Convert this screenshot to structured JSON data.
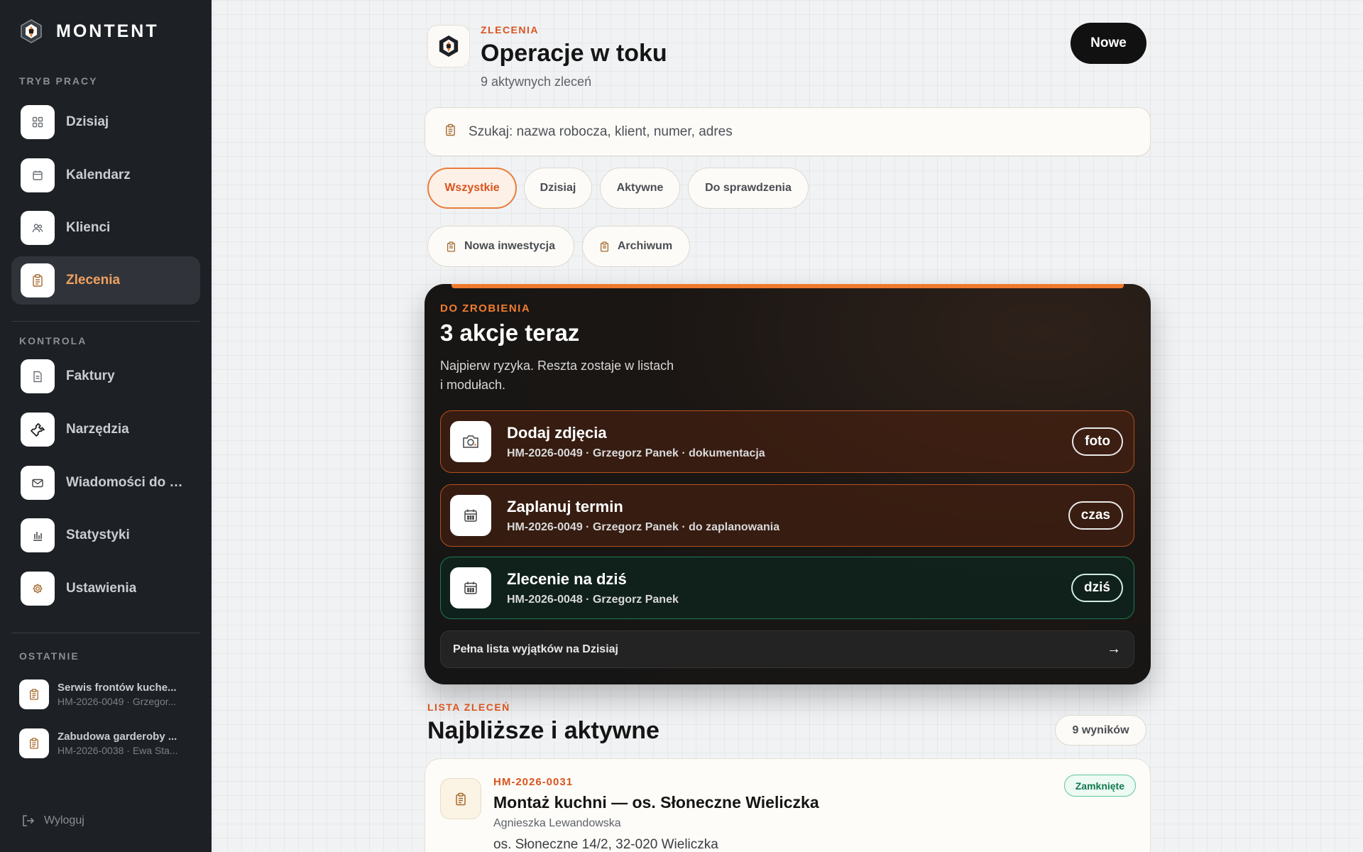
{
  "sidebar": {
    "brand": "MONTENT",
    "section_work": "TRYB PRACY",
    "nav_work": [
      {
        "label": "Dzisiaj",
        "icon": "grid-icon"
      },
      {
        "label": "Kalendarz",
        "icon": "calendar-icon"
      },
      {
        "label": "Klienci",
        "icon": "users-icon"
      },
      {
        "label": "Zlecenia",
        "icon": "clipboard-icon",
        "active": true
      }
    ],
    "section_control": "KONTROLA",
    "nav_control": [
      {
        "label": "Faktury",
        "icon": "document-icon"
      },
      {
        "label": "Narzędzia",
        "icon": "wrench-icon"
      },
      {
        "label": "Wiadomości do kl...",
        "icon": "mail-icon"
      },
      {
        "label": "Statystyki",
        "icon": "bar-chart-icon"
      },
      {
        "label": "Ustawienia",
        "icon": "gear-icon"
      }
    ],
    "section_recent": "OSTATNIE",
    "recent": [
      {
        "title": "Serwis frontów kuche...",
        "sub": "HM-2026-0049 · Grzegor..."
      },
      {
        "title": "Zabudowa garderoby ...",
        "sub": "HM-2026-0038 · Ewa Sta..."
      }
    ],
    "logout": "Wyloguj"
  },
  "header": {
    "eyebrow": "ZLECENIA",
    "title": "Operacje w toku",
    "subtitle": "9 aktywnych zleceń",
    "new_button": "Nowe"
  },
  "search": {
    "placeholder": "Szukaj: nazwa robocza, klient, numer, adres",
    "value": ""
  },
  "filters": {
    "primary": [
      "Wszystkie",
      "Dzisiaj",
      "Aktywne",
      "Do sprawdzenia"
    ],
    "active_index": 0,
    "secondary": [
      "Nowa inwestycja",
      "Archiwum"
    ]
  },
  "actions": {
    "eyebrow": "DO ZROBIENIA",
    "title": "3 akcje teraz",
    "description": "Najpierw ryzyka. Reszta zostaje w listach i modułach.",
    "items": [
      {
        "title": "Dodaj zdjęcia",
        "sub": "HM-2026-0049 · Grzegorz Panek · dokumentacja",
        "tag": "foto",
        "icon": "camera-icon",
        "tone": "orange"
      },
      {
        "title": "Zaplanuj termin",
        "sub": "HM-2026-0049 · Grzegorz Panek · do zaplanowania",
        "tag": "czas",
        "icon": "calendar-icon",
        "tone": "orange"
      },
      {
        "title": "Zlecenie na dziś",
        "sub": "HM-2026-0048 · Grzegorz Panek",
        "tag": "dziś",
        "icon": "calendar-icon",
        "tone": "green"
      }
    ],
    "full_list": "Pełna lista wyjątków na Dzisiaj",
    "full_list_arrow": "→"
  },
  "list": {
    "eyebrow": "LISTA ZLECEŃ",
    "title": "Najbliższe i aktywne",
    "results": "9 wyników",
    "orders": [
      {
        "number": "HM-2026-0031",
        "title": "Montaż kuchni — os. Słoneczne Wieliczka",
        "client": "Agnieszka Lewandowska",
        "address": "os. Słoneczne 14/2, 32-020 Wieliczka",
        "status": "Zamknięte"
      }
    ]
  },
  "colors": {
    "accent": "#d9541e",
    "accent_bar": "#ef7a2e",
    "sidebar_bg": "#1d2024",
    "status_green": "#0f7a4f"
  }
}
